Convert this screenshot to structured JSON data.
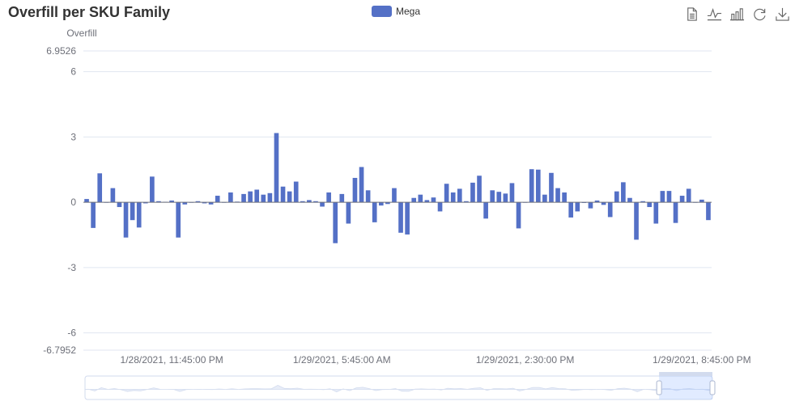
{
  "title": "Overfill per SKU Family",
  "legend": [
    {
      "name": "Mega",
      "color": "#5470C6"
    }
  ],
  "toolbox": [
    {
      "name": "data-view-icon",
      "title": "Data View"
    },
    {
      "name": "line-chart-icon",
      "title": "Switch to Line Chart"
    },
    {
      "name": "bar-chart-icon",
      "title": "Switch to Bar Chart"
    },
    {
      "name": "restore-icon",
      "title": "Restore"
    },
    {
      "name": "download-icon",
      "title": "Save as Image"
    }
  ],
  "chart_data": {
    "type": "bar",
    "ylabel": "Overfill",
    "ylim": [
      -6.7952,
      6.9526
    ],
    "yticks": [
      6.9526,
      6,
      3,
      0,
      -3,
      -6,
      -6.7952
    ],
    "xtick_labels": [
      "1/28/2021, 11:45:00 PM",
      "1/29/2021, 5:45:00 AM",
      "1/29/2021, 2:30:00 PM",
      "1/29/2021, 8:45:00 PM"
    ],
    "xtick_positions": [
      13,
      39,
      67,
      94
    ],
    "grid": true,
    "legend_position": "top-center",
    "series": [
      {
        "name": "Mega",
        "color": "#5470C6",
        "values": [
          0.15,
          -1.18,
          1.33,
          0,
          0.65,
          -0.22,
          -1.62,
          -0.82,
          -1.16,
          -0.05,
          1.18,
          0.05,
          0.02,
          0.08,
          -1.62,
          -0.1,
          0,
          0.05,
          -0.05,
          -0.1,
          0.3,
          0,
          0.45,
          0.03,
          0.38,
          0.5,
          0.58,
          0.35,
          0.42,
          3.18,
          0.72,
          0.5,
          0.95,
          0.05,
          0.1,
          0.05,
          -0.2,
          0.45,
          -1.88,
          0.38,
          -0.98,
          1.12,
          1.62,
          0.55,
          -0.92,
          -0.15,
          -0.08,
          0.65,
          -1.4,
          -1.48,
          0.2,
          0.35,
          0.1,
          0.22,
          -0.42,
          0.85,
          0.45,
          0.62,
          0.05,
          0.9,
          1.22,
          -0.75,
          0.55,
          0.48,
          0.4,
          0.88,
          -1.2,
          0,
          1.52,
          1.5,
          0.35,
          1.35,
          0.65,
          0.45,
          -0.7,
          -0.42,
          -0.03,
          -0.28,
          0.08,
          -0.12,
          -0.68,
          0.5,
          0.92,
          0.2,
          -1.72,
          0.05,
          -0.22,
          -0.98,
          0.52,
          0.52,
          -0.95,
          0.3,
          0.62,
          0,
          0.12,
          -0.82
        ]
      }
    ]
  },
  "data_zoom": {
    "start_percent": 91.5,
    "end_percent": 100
  }
}
